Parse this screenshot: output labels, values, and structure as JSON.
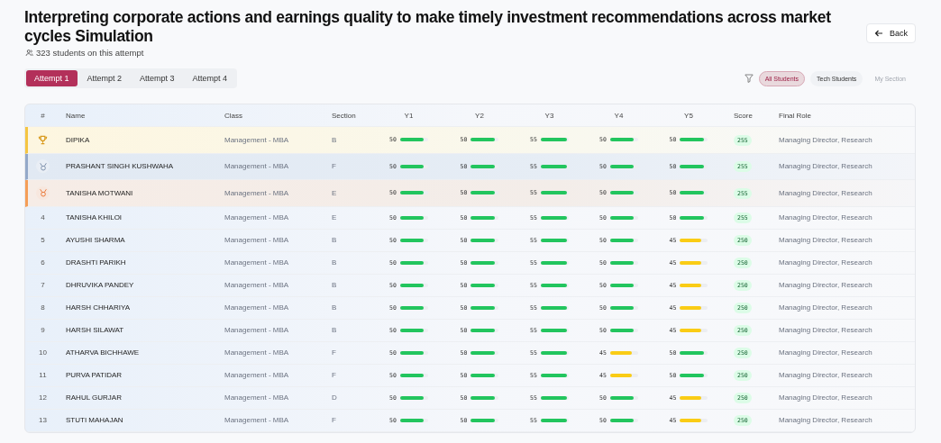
{
  "header": {
    "title": "Interpreting corporate actions and earnings quality to make timely investment recommendations across market cycles Simulation",
    "subtitle": "323 students on this attempt",
    "back_button": "Back"
  },
  "attempt_tabs": [
    {
      "label": "Attempt 1",
      "selected": true
    },
    {
      "label": "Attempt 2",
      "selected": false
    },
    {
      "label": "Attempt 3",
      "selected": false
    },
    {
      "label": "Attempt 4",
      "selected": false
    }
  ],
  "filters": [
    {
      "label": "All Students",
      "selected": true,
      "disabled": false
    },
    {
      "label": "Tech Students",
      "selected": false,
      "disabled": false
    },
    {
      "label": "My Section",
      "selected": false,
      "disabled": true
    }
  ],
  "table": {
    "columns": [
      "#",
      "Name",
      "Class",
      "Section",
      "Y1",
      "Y2",
      "Y3",
      "Y4",
      "Y5",
      "Score",
      "Final Role"
    ],
    "rows": [
      {
        "kind": "gold",
        "name": "DIPIKA",
        "class": "Management - MBA",
        "section": "B",
        "years": [
          {
            "value": "50",
            "level": 0.85,
            "color": "#22c55e"
          },
          {
            "value": "50",
            "level": 0.85,
            "color": "#22c55e"
          },
          {
            "value": "55",
            "level": 0.93,
            "color": "#22c55e"
          },
          {
            "value": "50",
            "level": 0.85,
            "color": "#22c55e"
          },
          {
            "value": "50",
            "level": 0.85,
            "color": "#22c55e"
          }
        ],
        "score": "255",
        "role": "Managing Director, Research"
      },
      {
        "kind": "silver",
        "name": "PRASHANT SINGH KUSHWAHA",
        "class": "Management - MBA",
        "section": "F",
        "years": [
          {
            "value": "50",
            "level": 0.85,
            "color": "#22c55e"
          },
          {
            "value": "50",
            "level": 0.85,
            "color": "#22c55e"
          },
          {
            "value": "55",
            "level": 0.93,
            "color": "#22c55e"
          },
          {
            "value": "50",
            "level": 0.85,
            "color": "#22c55e"
          },
          {
            "value": "50",
            "level": 0.85,
            "color": "#22c55e"
          }
        ],
        "score": "255",
        "role": "Managing Director, Research"
      },
      {
        "kind": "bronze",
        "name": "TANISHA MOTWANI",
        "class": "Management - MBA",
        "section": "E",
        "years": [
          {
            "value": "50",
            "level": 0.85,
            "color": "#22c55e"
          },
          {
            "value": "50",
            "level": 0.85,
            "color": "#22c55e"
          },
          {
            "value": "55",
            "level": 0.93,
            "color": "#22c55e"
          },
          {
            "value": "50",
            "level": 0.85,
            "color": "#22c55e"
          },
          {
            "value": "50",
            "level": 0.85,
            "color": "#22c55e"
          }
        ],
        "score": "255",
        "role": "Managing Director, Research"
      },
      {
        "kind": "plain",
        "rank": "4",
        "name": "TANISHA KHILOI",
        "class": "Management - MBA",
        "section": "E",
        "years": [
          {
            "value": "50",
            "level": 0.85,
            "color": "#22c55e"
          },
          {
            "value": "50",
            "level": 0.85,
            "color": "#22c55e"
          },
          {
            "value": "55",
            "level": 0.93,
            "color": "#22c55e"
          },
          {
            "value": "50",
            "level": 0.85,
            "color": "#22c55e"
          },
          {
            "value": "50",
            "level": 0.85,
            "color": "#22c55e"
          }
        ],
        "score": "255",
        "role": "Managing Director, Research"
      },
      {
        "kind": "plain",
        "rank": "5",
        "name": "AYUSHI SHARMA",
        "class": "Management - MBA",
        "section": "B",
        "years": [
          {
            "value": "50",
            "level": 0.85,
            "color": "#22c55e"
          },
          {
            "value": "50",
            "level": 0.85,
            "color": "#22c55e"
          },
          {
            "value": "55",
            "level": 0.93,
            "color": "#22c55e"
          },
          {
            "value": "50",
            "level": 0.85,
            "color": "#22c55e"
          },
          {
            "value": "45",
            "level": 0.77,
            "color": "#facc15"
          }
        ],
        "score": "250",
        "role": "Managing Director, Research"
      },
      {
        "kind": "plain",
        "rank": "6",
        "name": "DRASHTI PARIKH",
        "class": "Management - MBA",
        "section": "B",
        "years": [
          {
            "value": "50",
            "level": 0.85,
            "color": "#22c55e"
          },
          {
            "value": "50",
            "level": 0.85,
            "color": "#22c55e"
          },
          {
            "value": "55",
            "level": 0.93,
            "color": "#22c55e"
          },
          {
            "value": "50",
            "level": 0.85,
            "color": "#22c55e"
          },
          {
            "value": "45",
            "level": 0.77,
            "color": "#facc15"
          }
        ],
        "score": "250",
        "role": "Managing Director, Research"
      },
      {
        "kind": "plain",
        "rank": "7",
        "name": "DHRUVIKA PANDEY",
        "class": "Management - MBA",
        "section": "B",
        "years": [
          {
            "value": "50",
            "level": 0.85,
            "color": "#22c55e"
          },
          {
            "value": "50",
            "level": 0.85,
            "color": "#22c55e"
          },
          {
            "value": "55",
            "level": 0.93,
            "color": "#22c55e"
          },
          {
            "value": "50",
            "level": 0.85,
            "color": "#22c55e"
          },
          {
            "value": "45",
            "level": 0.77,
            "color": "#facc15"
          }
        ],
        "score": "250",
        "role": "Managing Director, Research"
      },
      {
        "kind": "plain",
        "rank": "8",
        "name": "HARSH CHHARIYA",
        "class": "Management - MBA",
        "section": "B",
        "years": [
          {
            "value": "50",
            "level": 0.85,
            "color": "#22c55e"
          },
          {
            "value": "50",
            "level": 0.85,
            "color": "#22c55e"
          },
          {
            "value": "55",
            "level": 0.93,
            "color": "#22c55e"
          },
          {
            "value": "50",
            "level": 0.85,
            "color": "#22c55e"
          },
          {
            "value": "45",
            "level": 0.77,
            "color": "#facc15"
          }
        ],
        "score": "250",
        "role": "Managing Director, Research"
      },
      {
        "kind": "plain",
        "rank": "9",
        "name": "HARSH SILAWAT",
        "class": "Management - MBA",
        "section": "B",
        "years": [
          {
            "value": "50",
            "level": 0.85,
            "color": "#22c55e"
          },
          {
            "value": "50",
            "level": 0.85,
            "color": "#22c55e"
          },
          {
            "value": "55",
            "level": 0.93,
            "color": "#22c55e"
          },
          {
            "value": "50",
            "level": 0.85,
            "color": "#22c55e"
          },
          {
            "value": "45",
            "level": 0.77,
            "color": "#facc15"
          }
        ],
        "score": "250",
        "role": "Managing Director, Research"
      },
      {
        "kind": "plain",
        "rank": "10",
        "name": "ATHARVA BICHHAWE",
        "class": "Management - MBA",
        "section": "F",
        "years": [
          {
            "value": "50",
            "level": 0.85,
            "color": "#22c55e"
          },
          {
            "value": "50",
            "level": 0.85,
            "color": "#22c55e"
          },
          {
            "value": "55",
            "level": 0.93,
            "color": "#22c55e"
          },
          {
            "value": "45",
            "level": 0.77,
            "color": "#facc15"
          },
          {
            "value": "50",
            "level": 0.85,
            "color": "#22c55e"
          }
        ],
        "score": "250",
        "role": "Managing Director, Research"
      },
      {
        "kind": "plain",
        "rank": "11",
        "name": "PURVA PATIDAR",
        "class": "Management - MBA",
        "section": "F",
        "years": [
          {
            "value": "50",
            "level": 0.85,
            "color": "#22c55e"
          },
          {
            "value": "50",
            "level": 0.85,
            "color": "#22c55e"
          },
          {
            "value": "55",
            "level": 0.93,
            "color": "#22c55e"
          },
          {
            "value": "45",
            "level": 0.77,
            "color": "#facc15"
          },
          {
            "value": "50",
            "level": 0.85,
            "color": "#22c55e"
          }
        ],
        "score": "250",
        "role": "Managing Director, Research"
      },
      {
        "kind": "plain",
        "rank": "12",
        "name": "RAHUL GURJAR",
        "class": "Management - MBA",
        "section": "D",
        "years": [
          {
            "value": "50",
            "level": 0.85,
            "color": "#22c55e"
          },
          {
            "value": "50",
            "level": 0.85,
            "color": "#22c55e"
          },
          {
            "value": "55",
            "level": 0.93,
            "color": "#22c55e"
          },
          {
            "value": "50",
            "level": 0.85,
            "color": "#22c55e"
          },
          {
            "value": "45",
            "level": 0.77,
            "color": "#facc15"
          }
        ],
        "score": "250",
        "role": "Managing Director, Research"
      },
      {
        "kind": "plain",
        "rank": "13",
        "name": "STUTI MAHAJAN",
        "class": "Management - MBA",
        "section": "F",
        "years": [
          {
            "value": "50",
            "level": 0.85,
            "color": "#22c55e"
          },
          {
            "value": "50",
            "level": 0.85,
            "color": "#22c55e"
          },
          {
            "value": "55",
            "level": 0.93,
            "color": "#22c55e"
          },
          {
            "value": "50",
            "level": 0.85,
            "color": "#22c55e"
          },
          {
            "value": "45",
            "level": 0.77,
            "color": "#facc15"
          }
        ],
        "score": "250",
        "role": "Managing Director, Research"
      }
    ]
  }
}
